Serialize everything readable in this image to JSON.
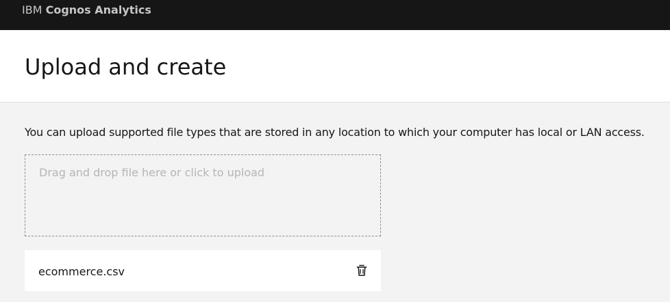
{
  "app": {
    "brand_prefix": "IBM",
    "brand_product": "Cognos Analytics"
  },
  "page": {
    "title": "Upload and create",
    "description": "You can upload supported file types that are stored in any location to which your computer has local or LAN access."
  },
  "dropzone": {
    "text": "Drag and drop file here or click to upload"
  },
  "files": [
    {
      "name": "ecommerce.csv",
      "action_icon": "trash-icon"
    }
  ],
  "colors": {
    "topbar": "#161616",
    "header": "#ffffff",
    "content": "#f3f3f3",
    "muted_text": "#b5b5b5"
  }
}
